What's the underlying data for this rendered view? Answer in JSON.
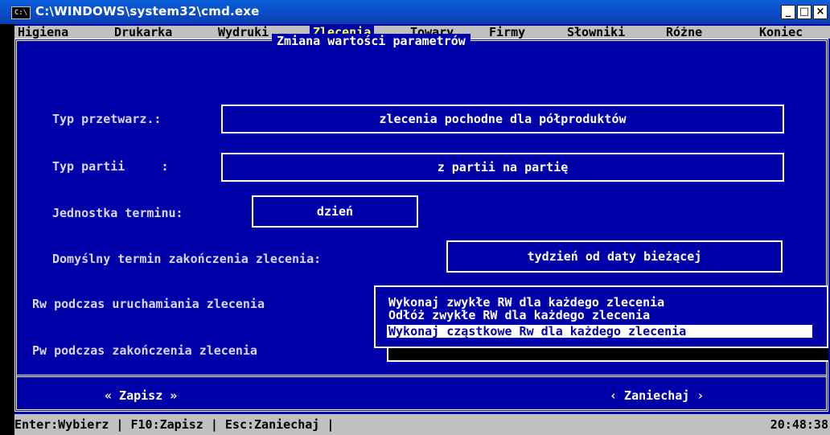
{
  "window": {
    "icon_text": "C:\\",
    "title": "C:\\WINDOWS\\system32\\cmd.exe",
    "minimize": "_",
    "maximize": "□",
    "close": "×"
  },
  "menu": {
    "items": [
      "Higiena",
      "Drukarka",
      "Wydruki",
      "Zlecenia",
      "Towary",
      "Firmy",
      "Słowniki",
      "Różne",
      "Koniec"
    ],
    "active": "Zlecenia"
  },
  "dialog": {
    "title": "Zmiana wartości parametrów",
    "fields": {
      "typ_przetwarz": {
        "label": "Typ przetwarz.:",
        "value": "zlecenia pochodne dla półproduktów"
      },
      "typ_partii": {
        "label": "Typ partii     :",
        "value": "z partii na partię"
      },
      "jednostka": {
        "label": "Jednostka terminu:",
        "value": "dzień"
      },
      "domyslny": {
        "label": "Domyślny termin zakończenia zlecenia:",
        "value": "tydzień od daty bieżącej"
      },
      "rw": {
        "label": "Rw podczas uruchamiania zlecenia"
      },
      "pw": {
        "label": "Pw podczas zakończenia zlecenia"
      }
    },
    "rw_options": [
      "Wykonaj zwykłe RW dla każdego zlecenia",
      "Odłóż zwykłe RW dla każdego zlecenia",
      "Wykonaj cząstkowe Rw dla każdego zlecenia"
    ],
    "rw_selected_index": 2,
    "save_button": "« Zapisz »",
    "cancel_button": "‹ Zaniechaj ›"
  },
  "status": {
    "help": "Enter:Wybierz | F10:Zapisz | Esc:Zaniechaj |",
    "time": "20:48:38"
  },
  "colors": {
    "console_bg": "#0000a8",
    "menu_bg": "#c0c0c0",
    "titlebar": "#0b4bc5"
  }
}
